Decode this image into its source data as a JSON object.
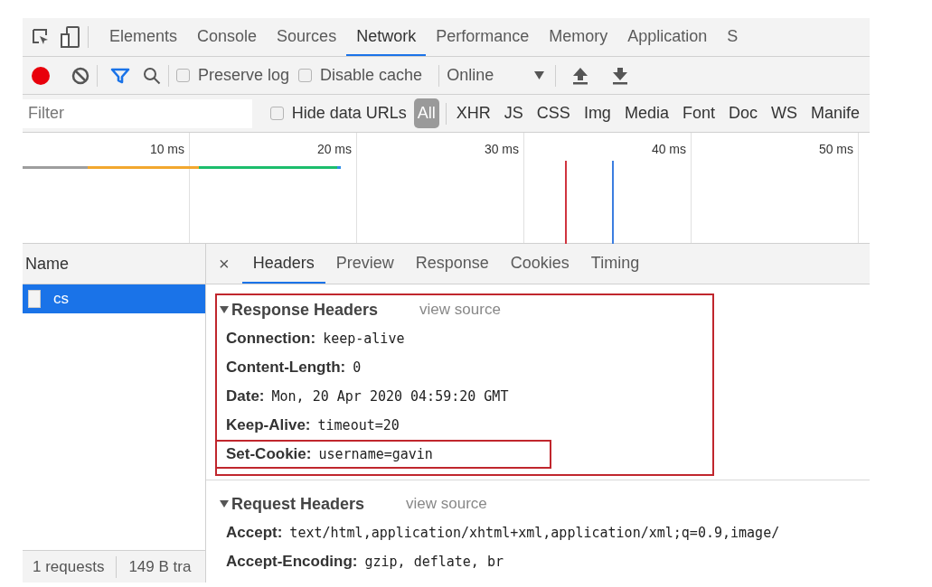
{
  "panel_tabs": [
    {
      "label": "Elements",
      "selected": false
    },
    {
      "label": "Console",
      "selected": false
    },
    {
      "label": "Sources",
      "selected": false
    },
    {
      "label": "Network",
      "selected": true
    },
    {
      "label": "Performance",
      "selected": false
    },
    {
      "label": "Memory",
      "selected": false
    },
    {
      "label": "Application",
      "selected": false
    },
    {
      "label": "S",
      "selected": false
    }
  ],
  "toolbar": {
    "recording": true,
    "filter_active": true,
    "checkboxes": [
      {
        "label": "Preserve log",
        "checked": false
      },
      {
        "label": "Disable cache",
        "checked": false
      }
    ],
    "throttle": "Online"
  },
  "filter": {
    "placeholder": "Filter",
    "hide_data_urls": {
      "label": "Hide data URLs",
      "checked": false
    },
    "types": [
      {
        "label": "All",
        "selected": true
      },
      {
        "label": "XHR",
        "selected": false
      },
      {
        "label": "JS",
        "selected": false
      },
      {
        "label": "CSS",
        "selected": false
      },
      {
        "label": "Img",
        "selected": false
      },
      {
        "label": "Media",
        "selected": false
      },
      {
        "label": "Font",
        "selected": false
      },
      {
        "label": "Doc",
        "selected": false
      },
      {
        "label": "WS",
        "selected": false
      },
      {
        "label": "Manife",
        "selected": false
      }
    ]
  },
  "overview": {
    "ticks": [
      "10 ms",
      "20 ms",
      "30 ms",
      "40 ms",
      "50 ms"
    ]
  },
  "requests": {
    "column": "Name",
    "rows": [
      {
        "name": "cs",
        "selected": true
      }
    ]
  },
  "status_bar": [
    "1 requests",
    "149 B tra"
  ],
  "detail": {
    "close": "×",
    "tabs": [
      {
        "label": "Headers",
        "selected": true
      },
      {
        "label": "Preview",
        "selected": false
      },
      {
        "label": "Response",
        "selected": false
      },
      {
        "label": "Cookies",
        "selected": false
      },
      {
        "label": "Timing",
        "selected": false
      }
    ],
    "sections": [
      {
        "title": "Response Headers",
        "link": "view source",
        "expanded": true,
        "highlighted": true,
        "headers": [
          {
            "name": "Connection:",
            "value": "keep-alive",
            "highlighted": false
          },
          {
            "name": "Content-Length:",
            "value": "0",
            "highlighted": false
          },
          {
            "name": "Date:",
            "value": "Mon, 20 Apr 2020 04:59:20 GMT",
            "highlighted": false
          },
          {
            "name": "Keep-Alive:",
            "value": "timeout=20",
            "highlighted": false
          },
          {
            "name": "Set-Cookie:",
            "value": "username=gavin",
            "highlighted": true
          }
        ]
      },
      {
        "title": "Request Headers",
        "link": "view source",
        "expanded": true,
        "highlighted": false,
        "headers": [
          {
            "name": "Accept:",
            "value": "text/html,application/xhtml+xml,application/xml;q=0.9,image/",
            "highlighted": false
          },
          {
            "name": "Accept-Encoding:",
            "value": "gzip, deflate, br",
            "highlighted": false
          }
        ]
      }
    ]
  }
}
